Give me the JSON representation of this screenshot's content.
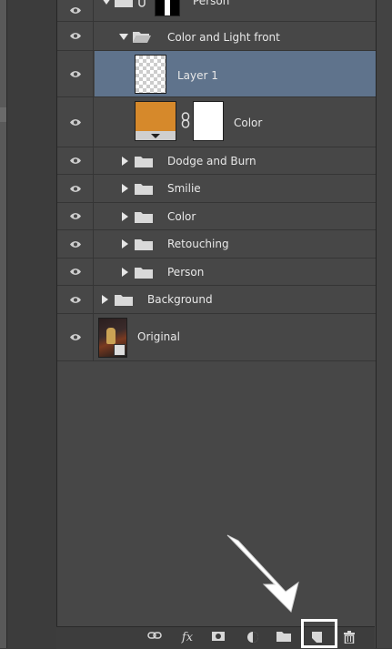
{
  "layers": [
    {
      "label": "Person",
      "type": "group-clipped-top",
      "expanded": true
    },
    {
      "label": "Color and Light front",
      "type": "group",
      "expanded": true
    },
    {
      "label": "Layer 1",
      "type": "layer",
      "selected": true
    },
    {
      "label": "Color",
      "type": "fill-layer",
      "swatch": "#d6892b"
    },
    {
      "label": "Dodge and Burn",
      "type": "group",
      "expanded": false
    },
    {
      "label": "Smilie",
      "type": "group",
      "expanded": false
    },
    {
      "label": "Color",
      "type": "group",
      "expanded": false
    },
    {
      "label": "Retouching",
      "type": "group",
      "expanded": false
    },
    {
      "label": "Person",
      "type": "group",
      "expanded": false
    },
    {
      "label": "Background",
      "type": "group",
      "expanded": false
    },
    {
      "label": "Original",
      "type": "image-layer"
    }
  ],
  "toolbar": {
    "icons": [
      "link-layers-icon",
      "fx-icon",
      "add-mask-icon",
      "adjustment-layer-icon",
      "new-group-icon",
      "new-layer-icon",
      "trash-icon"
    ],
    "fx_label": "fx",
    "highlighted": "new-layer-icon"
  },
  "colors": {
    "panel": "#474747",
    "selected": "#5f738c",
    "highlight": "#ffffff",
    "swatch": "#d6892b"
  }
}
